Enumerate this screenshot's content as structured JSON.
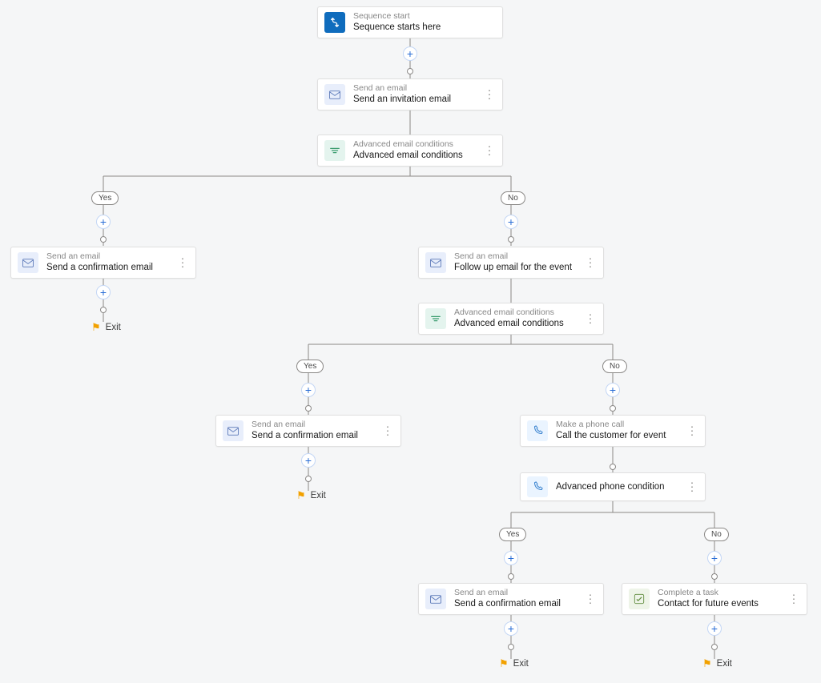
{
  "labels": {
    "yes": "Yes",
    "no": "No",
    "exit": "Exit"
  },
  "nodes": {
    "start": {
      "type": "Sequence start",
      "title": "Sequence starts here"
    },
    "email1": {
      "type": "Send an email",
      "title": "Send an invitation email"
    },
    "cond1": {
      "type": "Advanced email conditions",
      "title": "Advanced email conditions"
    },
    "email2": {
      "type": "Send an email",
      "title": "Send a confirmation email"
    },
    "email3": {
      "type": "Send an email",
      "title": "Follow up email for the event"
    },
    "cond2": {
      "type": "Advanced email conditions",
      "title": "Advanced email conditions"
    },
    "email4": {
      "type": "Send an email",
      "title": "Send a confirmation email"
    },
    "phone1": {
      "type": "Make a phone call",
      "title": "Call the customer for event"
    },
    "cond3": {
      "type": "",
      "title": "Advanced phone condition"
    },
    "email5": {
      "type": "Send an email",
      "title": "Send a confirmation email"
    },
    "task1": {
      "type": "Complete a task",
      "title": "Contact for future events"
    }
  }
}
